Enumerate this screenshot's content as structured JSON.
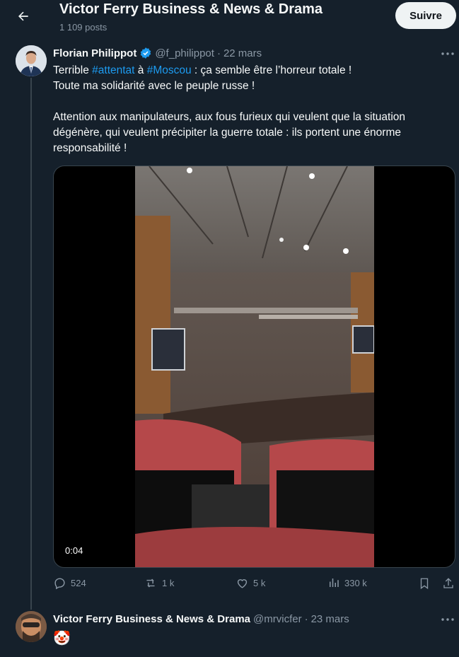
{
  "header": {
    "title": "Victor Ferry Business & News & Drama",
    "subtitle": "1 109 posts",
    "follow_label": "Suivre"
  },
  "tweet": {
    "author_name": "Florian Philippot",
    "handle": "@f_philippot",
    "separator": "·",
    "date": "22 mars",
    "text_line1_a": "Terrible ",
    "hashtag1": "#attentat",
    "text_line1_b": " à ",
    "hashtag2": "#Moscou",
    "text_line1_c": " : ça semble être l’horreur totale !",
    "text_line2": "Toute ma solidarité avec le peuple russe !",
    "text_para2": "Attention aux manipulateurs, aux fous furieux qui veulent que la situation dégénère, qui veulent précipiter la guerre totale : ils portent une énorme responsabilité !",
    "video_time": "0:04",
    "stats": {
      "replies": "524",
      "reposts": "1 k",
      "likes": "5 k",
      "views": "330 k"
    }
  },
  "reply": {
    "author_name": "Victor Ferry Business & News & Drama",
    "handle": "@mrvicfer",
    "separator": "·",
    "date": "23 mars",
    "text": "🤡"
  },
  "colors": {
    "background": "#15202b",
    "link": "#1d9bf0",
    "muted": "#8b98a5",
    "verified": "#1d9bf0"
  },
  "icons": [
    "back-arrow-icon",
    "verified-badge-icon",
    "more-icon",
    "reply-icon",
    "repost-icon",
    "like-icon",
    "views-icon",
    "bookmark-icon",
    "share-icon"
  ]
}
